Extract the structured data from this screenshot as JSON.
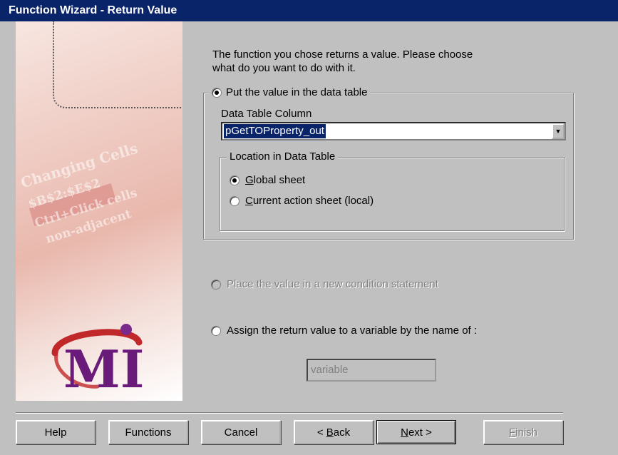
{
  "window": {
    "title": "Function Wizard - Return Value"
  },
  "intro_text_line1": "The function you chose returns a value. Please choose",
  "intro_text_line2": "what do you want to do with it.",
  "options": {
    "data_table": {
      "label": "Put the value in the data table",
      "selected": true
    },
    "condition": {
      "label": "Place the value in a new condition statement",
      "enabled": false
    },
    "variable": {
      "label": "Assign the return value to a variable by the name of :",
      "selected": false
    }
  },
  "data_table_column": {
    "label": "Data Table Column",
    "value": "pGetTOProperty_out"
  },
  "location": {
    "label": "Location in Data Table",
    "global": {
      "label_first": "G",
      "label_rest": "lobal sheet",
      "selected": true
    },
    "local": {
      "label_first": "C",
      "label_rest": "urrent action sheet (local)",
      "selected": false
    }
  },
  "variable_field": {
    "value": "variable"
  },
  "buttons": {
    "help": "Help",
    "functions": "Functions",
    "cancel": "Cancel",
    "back_prefix": "< ",
    "back_first": "B",
    "back_rest": "ack",
    "next_first": "N",
    "next_rest": "ext >",
    "finish_first": "F",
    "finish_rest": "inish"
  },
  "art": {
    "phrase1": "Changing Cells",
    "phrase2": "$B$2:$E$2",
    "phrase3": "Ctrl+Click cells",
    "phrase4": "non-adjacent"
  },
  "logo": {
    "letters": "MI"
  },
  "colors": {
    "titlebar": "#0a246a",
    "selection": "#0a246a",
    "face": "#c0c0c0",
    "logo_red": "#c0282a",
    "logo_purple": "#6a1a7a"
  }
}
